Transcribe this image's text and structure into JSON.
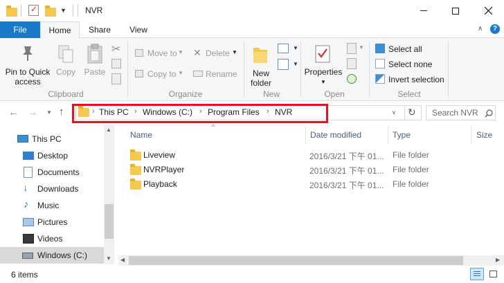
{
  "window": {
    "title": "NVR",
    "minimize_glyph": "—",
    "maximize_glyph": "☐",
    "close_glyph": "✕"
  },
  "ribbon_tabs": [
    "File",
    "Home",
    "Share",
    "View"
  ],
  "ribbon": {
    "clipboard": {
      "pin_label_1": "Pin to Quick",
      "pin_label_2": "access",
      "copy": "Copy",
      "paste": "Paste",
      "group": "Clipboard"
    },
    "organize": {
      "move_to": "Move to",
      "copy_to": "Copy to",
      "delete": "Delete",
      "rename": "Rename",
      "group": "Organize"
    },
    "new": {
      "new_folder_1": "New",
      "new_folder_2": "folder",
      "group": "New"
    },
    "open": {
      "properties": "Properties",
      "group": "Open"
    },
    "select": {
      "select_all": "Select all",
      "select_none": "Select none",
      "invert_selection": "Invert selection",
      "group": "Select"
    }
  },
  "address": {
    "crumbs": [
      "This PC",
      "Windows (C:)",
      "Program Files",
      "NVR"
    ],
    "search_placeholder": "Search NVR"
  },
  "nav": [
    {
      "label": "This PC",
      "icon": "computer-icon"
    },
    {
      "label": "Desktop",
      "icon": "desktop-icon"
    },
    {
      "label": "Documents",
      "icon": "documents-icon"
    },
    {
      "label": "Downloads",
      "icon": "downloads-icon"
    },
    {
      "label": "Music",
      "icon": "music-icon"
    },
    {
      "label": "Pictures",
      "icon": "pictures-icon"
    },
    {
      "label": "Videos",
      "icon": "videos-icon"
    },
    {
      "label": "Windows (C:)",
      "icon": "drive-icon"
    }
  ],
  "columns": [
    "Name",
    "Date modified",
    "Type",
    "Size"
  ],
  "files": [
    {
      "name": "Liveview",
      "date": "2016/3/21 下午 01...",
      "type": "File folder"
    },
    {
      "name": "NVRPlayer",
      "date": "2016/3/21 下午 01...",
      "type": "File folder"
    },
    {
      "name": "Playback",
      "date": "2016/3/21 下午 01...",
      "type": "File folder"
    }
  ],
  "status": {
    "item_count": "6 items"
  },
  "colors": {
    "file_tab": "#1979ca",
    "highlight": "#e81123",
    "folder": "#f4c94e"
  }
}
